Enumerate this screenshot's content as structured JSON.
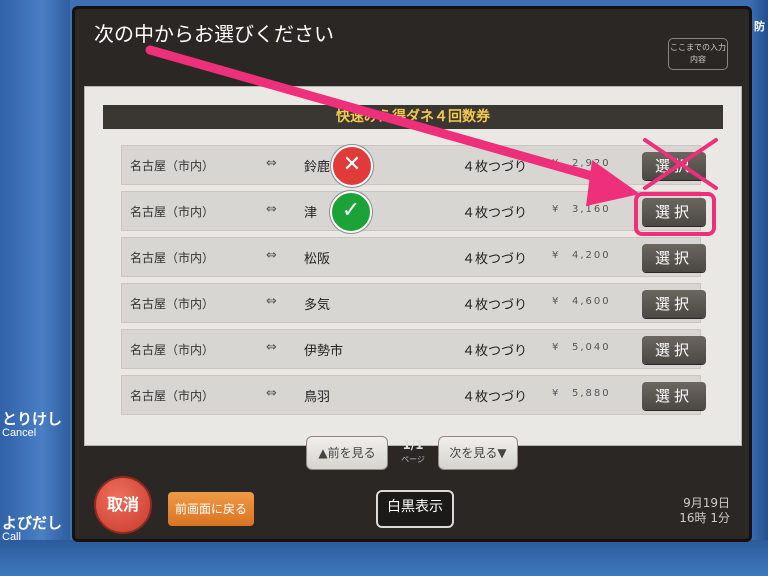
{
  "screen": {
    "title": "次の中からお選びください",
    "input_button": "ここまでの入力内容"
  },
  "ticket_type": "快速みえ得ダネ４回数券",
  "rows": [
    {
      "from": "名古屋（市内）",
      "arrow": "⇔",
      "to": "鈴鹿",
      "type": "４枚つづり",
      "yen": "¥",
      "price": "2,920",
      "select": "選択"
    },
    {
      "from": "名古屋（市内）",
      "arrow": "⇔",
      "to": "津",
      "type": "４枚つづり",
      "yen": "¥",
      "price": "3,160",
      "select": "選択"
    },
    {
      "from": "名古屋（市内）",
      "arrow": "⇔",
      "to": "松阪",
      "type": "４枚つづり",
      "yen": "¥",
      "price": "4,200",
      "select": "選択"
    },
    {
      "from": "名古屋（市内）",
      "arrow": "⇔",
      "to": "多気",
      "type": "４枚つづり",
      "yen": "¥",
      "price": "4,600",
      "select": "選択"
    },
    {
      "from": "名古屋（市内）",
      "arrow": "⇔",
      "to": "伊勢市",
      "type": "４枚つづり",
      "yen": "¥",
      "price": "5,040",
      "select": "選択"
    },
    {
      "from": "名古屋（市内）",
      "arrow": "⇔",
      "to": "鳥羽",
      "type": "４枚つづり",
      "yen": "¥",
      "price": "5,880",
      "select": "選択"
    }
  ],
  "pager": {
    "prev": "▲前を見る",
    "page": "1/1",
    "page_label": "ページ",
    "next": "次を見る▼"
  },
  "footer": {
    "cancel": "取消",
    "back": "前画面に戻る",
    "mono": "白黒表示",
    "date": "9月19日",
    "time": "16時 1分"
  },
  "machine": {
    "cancel_jp": "とりけし",
    "cancel_en": "Cancel",
    "call_jp": "よびだし",
    "call_en": "Call",
    "right_label": "防"
  },
  "annotations": {
    "wrong_mark": "✕",
    "correct_mark": "✓",
    "arrow_color": "#ee2f7a",
    "highlight_color": "#ee2f7a"
  }
}
